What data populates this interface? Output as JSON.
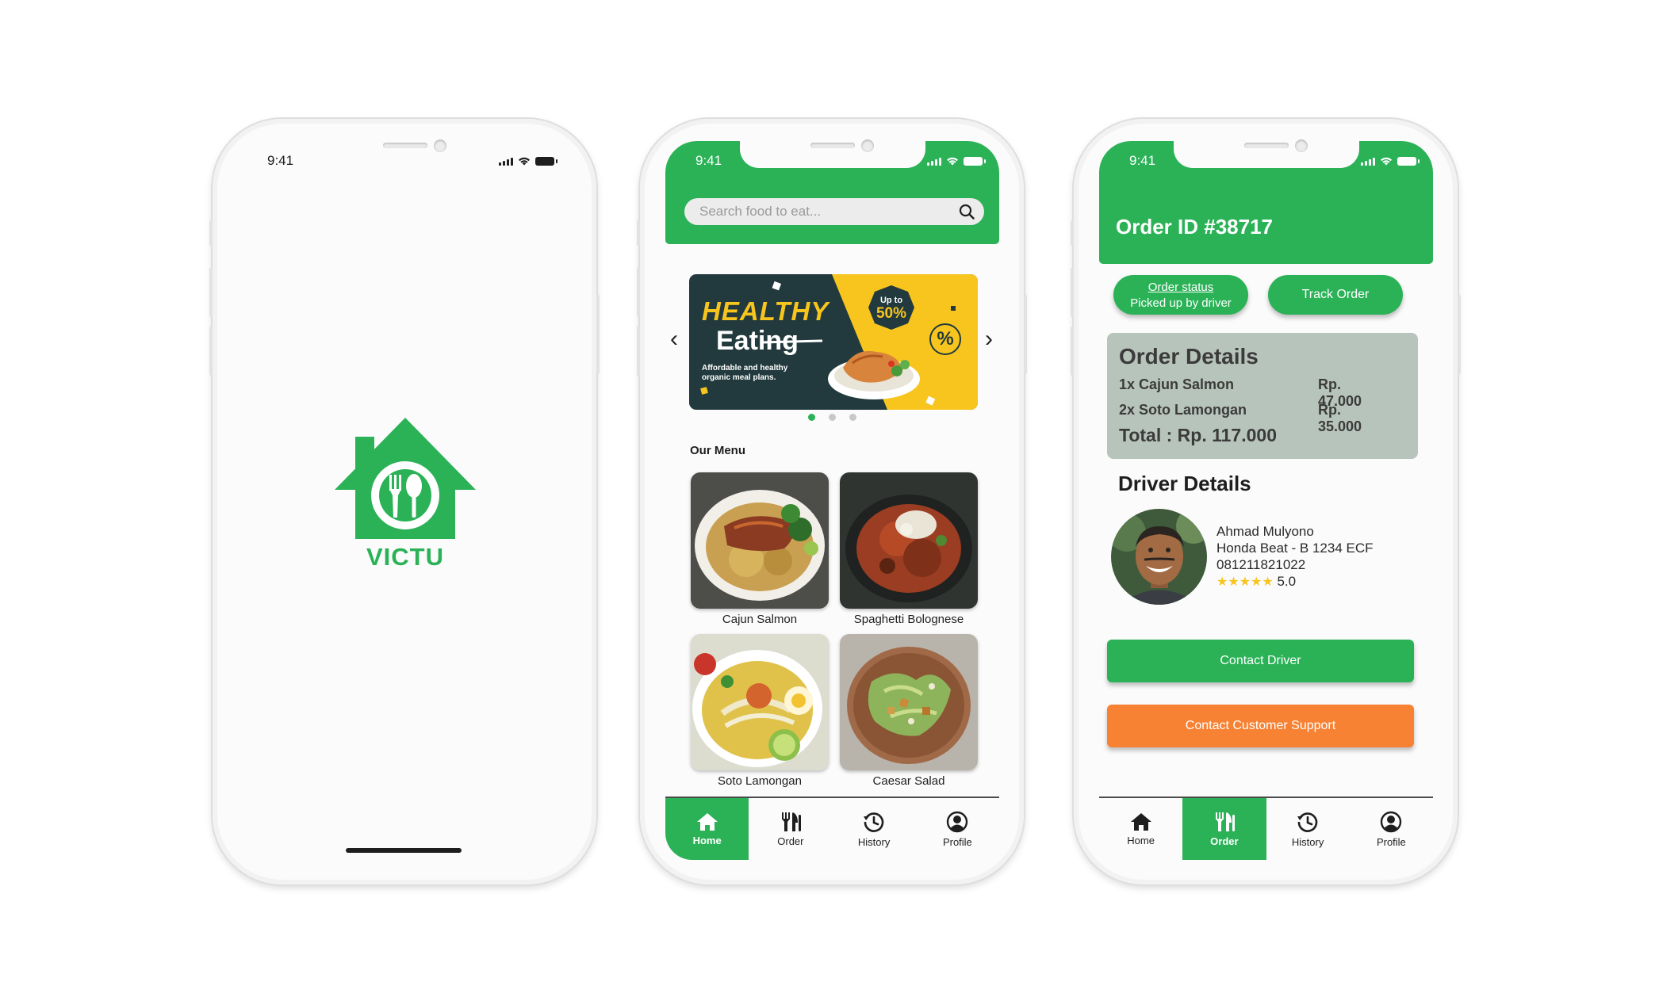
{
  "colors": {
    "brand_green": "#2bb257",
    "orange": "#f78234",
    "order_box": "#b7c4bb",
    "banner_dark": "#223a3d",
    "banner_yellow": "#f7c51e"
  },
  "splash": {
    "status": {
      "time": "9:41"
    },
    "brand": "VICTU",
    "logo_icon": "house-fork-spoon-icon"
  },
  "home": {
    "status": {
      "time": "9:41"
    },
    "search": {
      "placeholder": "Search food to eat...",
      "icon": "search-icon"
    },
    "banner": {
      "title_line1": "HEALTHY",
      "title_line2": "Eating",
      "subtitle": "Affordable and healthy organic meal plans.",
      "badge_line1": "Up to",
      "badge_line2": "50%",
      "percent_symbol": "%",
      "slide_count": 3,
      "active_slide": 1
    },
    "menu": {
      "title": "Our Menu",
      "items": [
        {
          "label": "Cajun Salmon"
        },
        {
          "label": "Spaghetti Bolognese"
        },
        {
          "label": "Soto Lamongan"
        },
        {
          "label": "Caesar Salad"
        }
      ]
    },
    "tabs": [
      {
        "label": "Home",
        "icon": "home-icon"
      },
      {
        "label": "Order",
        "icon": "fork-knife-icon"
      },
      {
        "label": "History",
        "icon": "history-icon"
      },
      {
        "label": "Profile",
        "icon": "profile-icon"
      }
    ],
    "active_tab": "Home"
  },
  "order": {
    "status": {
      "time": "9:41"
    },
    "title": "Order ID #38717",
    "status_pill": {
      "label": "Order status",
      "value": "Picked up by driver"
    },
    "track_button": "Track Order",
    "details": {
      "title": "Order Details",
      "items": [
        {
          "name": "1x Cajun Salmon",
          "price": "Rp. 47.000"
        },
        {
          "name": "2x Soto Lamongan",
          "price": "Rp. 35.000"
        }
      ],
      "total": "Total : Rp. 117.000"
    },
    "driver": {
      "title": "Driver Details",
      "name": "Ahmad Mulyono",
      "vehicle": "Honda Beat - B 1234 ECF",
      "phone": "081211821022",
      "stars": "★★★★★",
      "rating": "5.0"
    },
    "contact_driver": "Contact Driver",
    "contact_support": "Contact Customer Support",
    "tabs": [
      {
        "label": "Home",
        "icon": "home-icon"
      },
      {
        "label": "Order",
        "icon": "fork-knife-icon"
      },
      {
        "label": "History",
        "icon": "history-icon"
      },
      {
        "label": "Profile",
        "icon": "profile-icon"
      }
    ],
    "active_tab": "Order"
  }
}
